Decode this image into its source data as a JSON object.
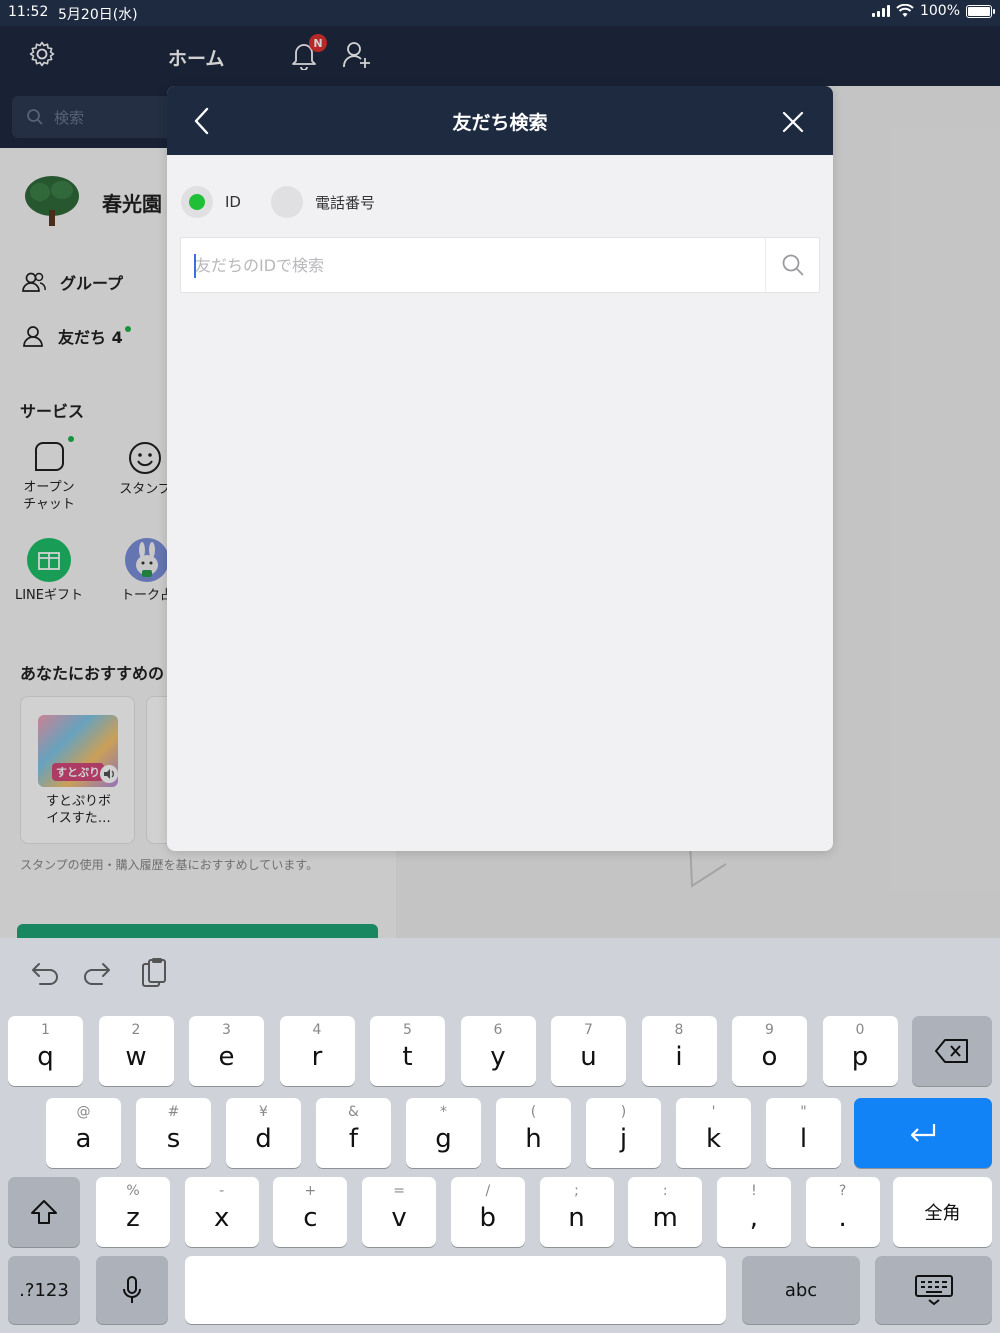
{
  "status_bar": {
    "time": "11:52",
    "date": "5月20日(水)",
    "battery": "100%"
  },
  "sidebar": {
    "title": "ホーム",
    "notification_badge": "N",
    "search_placeholder": "検索",
    "profile_name": "春光園",
    "items": [
      {
        "label": "グループ"
      },
      {
        "label": "友だち 4"
      }
    ],
    "services_title": "サービス",
    "services": [
      {
        "label": "オープン\nチャット"
      },
      {
        "label": "スタンプ"
      },
      {
        "label": "LINEギフト"
      },
      {
        "label": "トーク占"
      }
    ],
    "reco_title": "あなたにおすすめの",
    "reco_card_text": "すとぷりボイスすた…",
    "reco_sticker_caption": "すとぷり",
    "reco_note": "スタンプの使用・購入履歴を基におすすめしています。"
  },
  "modal": {
    "title": "友だち検索",
    "radio_id_label": "ID",
    "radio_phone_label": "電話番号",
    "selected": "ID",
    "search_placeholder": "友だちのIDで検索",
    "search_value": ""
  },
  "keyboard": {
    "row1": [
      {
        "sub": "1",
        "ch": "q"
      },
      {
        "sub": "2",
        "ch": "w"
      },
      {
        "sub": "3",
        "ch": "e"
      },
      {
        "sub": "4",
        "ch": "r"
      },
      {
        "sub": "5",
        "ch": "t"
      },
      {
        "sub": "6",
        "ch": "y"
      },
      {
        "sub": "7",
        "ch": "u"
      },
      {
        "sub": "8",
        "ch": "i"
      },
      {
        "sub": "9",
        "ch": "o"
      },
      {
        "sub": "0",
        "ch": "p"
      }
    ],
    "row2": [
      {
        "sub": "@",
        "ch": "a"
      },
      {
        "sub": "#",
        "ch": "s"
      },
      {
        "sub": "¥",
        "ch": "d"
      },
      {
        "sub": "&",
        "ch": "f"
      },
      {
        "sub": "*",
        "ch": "g"
      },
      {
        "sub": "(",
        "ch": "h"
      },
      {
        "sub": ")",
        "ch": "j"
      },
      {
        "sub": "'",
        "ch": "k"
      },
      {
        "sub": "\"",
        "ch": "l"
      }
    ],
    "row3": [
      {
        "sub": "%",
        "ch": "z"
      },
      {
        "sub": "-",
        "ch": "x"
      },
      {
        "sub": "+",
        "ch": "c"
      },
      {
        "sub": "=",
        "ch": "v"
      },
      {
        "sub": "/",
        "ch": "b"
      },
      {
        "sub": ";",
        "ch": "n"
      },
      {
        "sub": ":",
        "ch": "m"
      },
      {
        "sub": "!",
        "ch": ","
      },
      {
        "sub": "?",
        "ch": "."
      }
    ],
    "zenkaku_label": "全角",
    "num_label": ".?123",
    "abc_label": "abc"
  },
  "colors": {
    "header_navy": "#1e2a40",
    "line_green": "#1fbf38",
    "return_blue": "#1282f7"
  }
}
